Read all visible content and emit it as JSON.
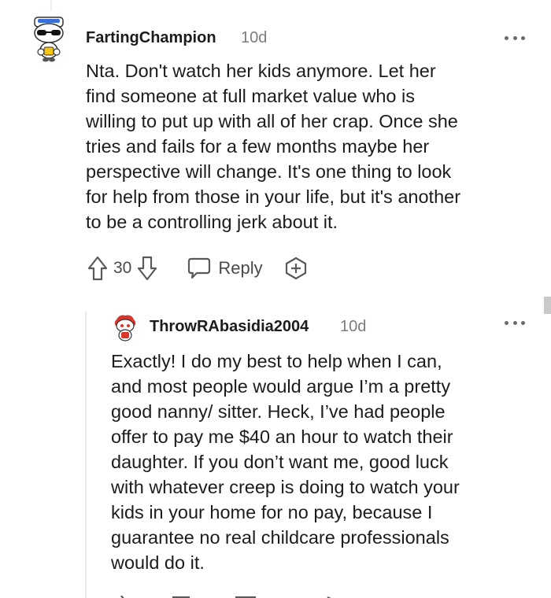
{
  "comment": {
    "username": "FartingChampion",
    "timestamp": "10d",
    "lines": [
      "Nta. Don't watch her kids anymore. Let her",
      "find someone at full market value who is",
      "willing to put up with all of her crap. Once she",
      "tries and fails for a few months maybe her",
      "perspective will change. It's one thing to look",
      "for help from those in your life, but it's another",
      "to be a controlling jerk about it."
    ],
    "vote_count": "30",
    "reply_label": "Reply"
  },
  "reply": {
    "username": "ThrowRAbasidia2004",
    "timestamp": "10d",
    "lines": [
      "Exactly! I do my best to help when I can,",
      "and most people would argue I’m a pretty",
      "good nanny/ sitter. Heck, I’ve had people",
      "offer to pay me $40 an hour to watch their",
      "daughter. If you don’t want me, good luck",
      "with whatever creep is doing to watch your",
      "kids in your home for no pay, because I",
      "guarantee no real childcare professionals",
      "would do it."
    ]
  },
  "icons": {
    "comment_avatar": "snoo-sailor-sunglasses-avatar",
    "reply_avatar": "snoo-red-hair-avatar",
    "more": "more-options-icon",
    "upvote": "upvote-arrow-icon",
    "downvote": "downvote-arrow-icon",
    "reply": "reply-bubble-icon",
    "award": "award-plus-icon"
  }
}
